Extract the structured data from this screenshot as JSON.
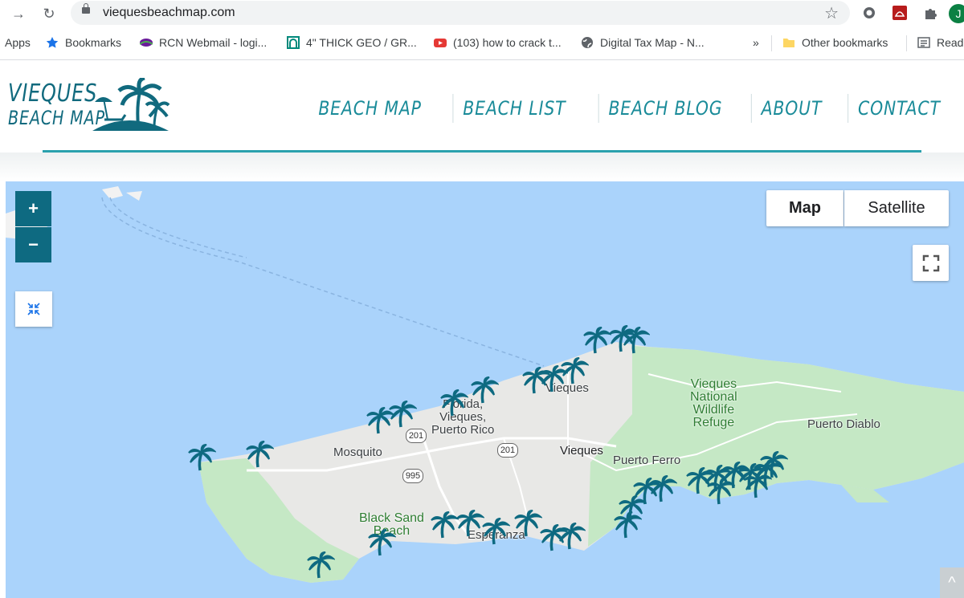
{
  "browser": {
    "url": "viequesbeachmap.com",
    "profile_initial": "J"
  },
  "bookmarks": [
    {
      "label": "Apps",
      "icon": "apps-icon"
    },
    {
      "label": "Bookmarks",
      "icon": "star-icon"
    },
    {
      "label": "RCN Webmail - logi...",
      "icon": "rcn-icon"
    },
    {
      "label": "4\" THICK GEO / GR...",
      "icon": "geo-icon"
    },
    {
      "label": "(103) how to crack t...",
      "icon": "youtube-icon"
    },
    {
      "label": "Digital Tax Map - N...",
      "icon": "globe-icon"
    },
    {
      "label": "Other bookmarks",
      "icon": "folder-icon"
    },
    {
      "label": "Read",
      "icon": "reading-list-icon"
    }
  ],
  "site": {
    "logo_line1": "VIEQUES",
    "logo_line2": "BEACH MAP",
    "nav": [
      "BEACH MAP",
      "BEACH LIST",
      "BEACH BLOG",
      "ABOUT",
      "CONTACT"
    ],
    "accent_color": "#1a8b99",
    "marker_color": "#0e6a81"
  },
  "map": {
    "zoom_in": "+",
    "zoom_out": "−",
    "map_type_options": [
      "Map",
      "Satellite"
    ],
    "selected_map_type": "Map",
    "labels": {
      "vieques_town": "Vieques",
      "florida": "Florida,\nVieques,\nPuerto Rico",
      "mosquito": "Mosquito",
      "vieques_center": "Vieques",
      "refuge": "Vieques\nNational\nWildlife\nRefuge",
      "puerto_diablo": "Puerto Diablo",
      "puerto_ferro": "Puerto Ferro",
      "black_sand": "Black Sand\nBeach",
      "esperanza": "Esperanza"
    },
    "route_shields": [
      "201",
      "201",
      "995"
    ]
  }
}
